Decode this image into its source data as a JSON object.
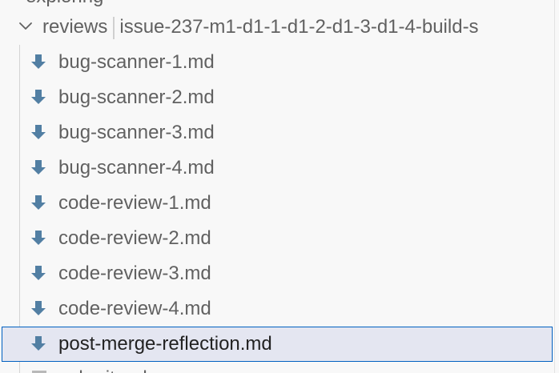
{
  "explorer": {
    "clipped_top_label": "exploring",
    "folder": {
      "name": "reviews",
      "sub": "issue-237-m1-d1-1-d1-2-d1-3-d1-4-build-s"
    },
    "files": [
      {
        "label": "bug-scanner-1.md",
        "icon": "markdown-download-icon"
      },
      {
        "label": "bug-scanner-2.md",
        "icon": "markdown-download-icon"
      },
      {
        "label": "bug-scanner-3.md",
        "icon": "markdown-download-icon"
      },
      {
        "label": "bug-scanner-4.md",
        "icon": "markdown-download-icon"
      },
      {
        "label": "code-review-1.md",
        "icon": "markdown-download-icon"
      },
      {
        "label": "code-review-2.md",
        "icon": "markdown-download-icon"
      },
      {
        "label": "code-review-3.md",
        "icon": "markdown-download-icon"
      },
      {
        "label": "code-review-4.md",
        "icon": "markdown-download-icon"
      },
      {
        "label": "post-merge-reflection.md",
        "icon": "markdown-download-icon",
        "selected": true
      }
    ],
    "clipped_bottom_label": "submit.md"
  },
  "colors": {
    "icon": "#527fa3",
    "selection_border": "#0060c0",
    "selection_bg": "#e4e6f1"
  }
}
